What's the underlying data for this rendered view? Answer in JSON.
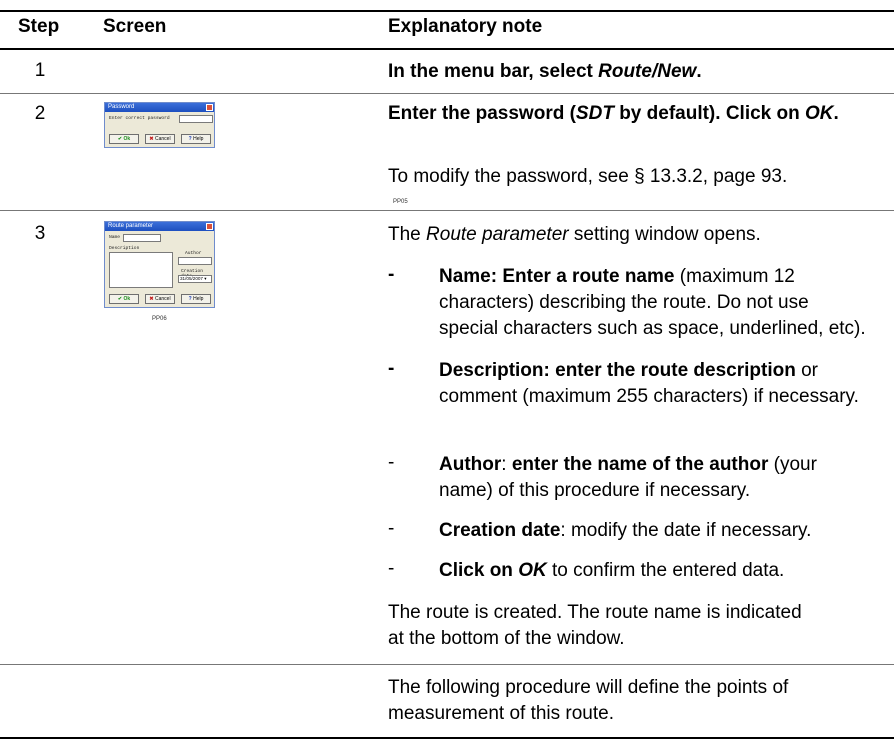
{
  "header": {
    "step": "Step",
    "screen": "Screen",
    "note": "Explanatory note"
  },
  "steps": [
    {
      "number": "1",
      "note": "In the menu bar, select Route/New."
    },
    {
      "number": "2",
      "note_bold": "Enter the password (SDT by default). Click on OK.",
      "note_plain": "To modify the password, see § 13.3.2, page 93.",
      "screenshot_caption": "PP05",
      "dialog": {
        "title": "Password",
        "prompt": "Enter correct password",
        "ok": "Ok",
        "cancel": "Cancel",
        "help": "Help"
      }
    },
    {
      "number": "3",
      "intro_pre": "The ",
      "intro_em": "Route parameter",
      "intro_post": " setting window opens.",
      "items": [
        {
          "dash": "-",
          "bold": "Name: Enter a route name",
          "text": " (maximum 12 characters) describing the route. Do not use special characters such as space, underlined, etc)."
        },
        {
          "dash": "-",
          "bold": "Description: enter the route description",
          "text": " or comment (maximum 255 characters) if necessary."
        },
        {
          "dash": "-",
          "bold": "Author",
          "mid": ": ",
          "bold2": "enter the name of the author",
          "text": " (your name) of this procedure if necessary."
        },
        {
          "dash": "-",
          "bold": "Creation date",
          "text": ": modify the date if necessary."
        },
        {
          "dash": "-",
          "bold": "Click on OK",
          "text": " to confirm the entered data."
        }
      ],
      "outro": "The route is created. The route name is indicated at the bottom of the window.",
      "screenshot_caption": "PP06",
      "dialog": {
        "title": "Route parameter",
        "name_label": "Name",
        "description_label": "Description",
        "author_label": "Author",
        "creation_date_label": "Creation date",
        "creation_date_value": "31/05/2007",
        "ok": "Ok",
        "cancel": "Cancel",
        "help": "Help"
      }
    }
  ],
  "footer_note": "The following procedure will define the points of measurement of this route."
}
